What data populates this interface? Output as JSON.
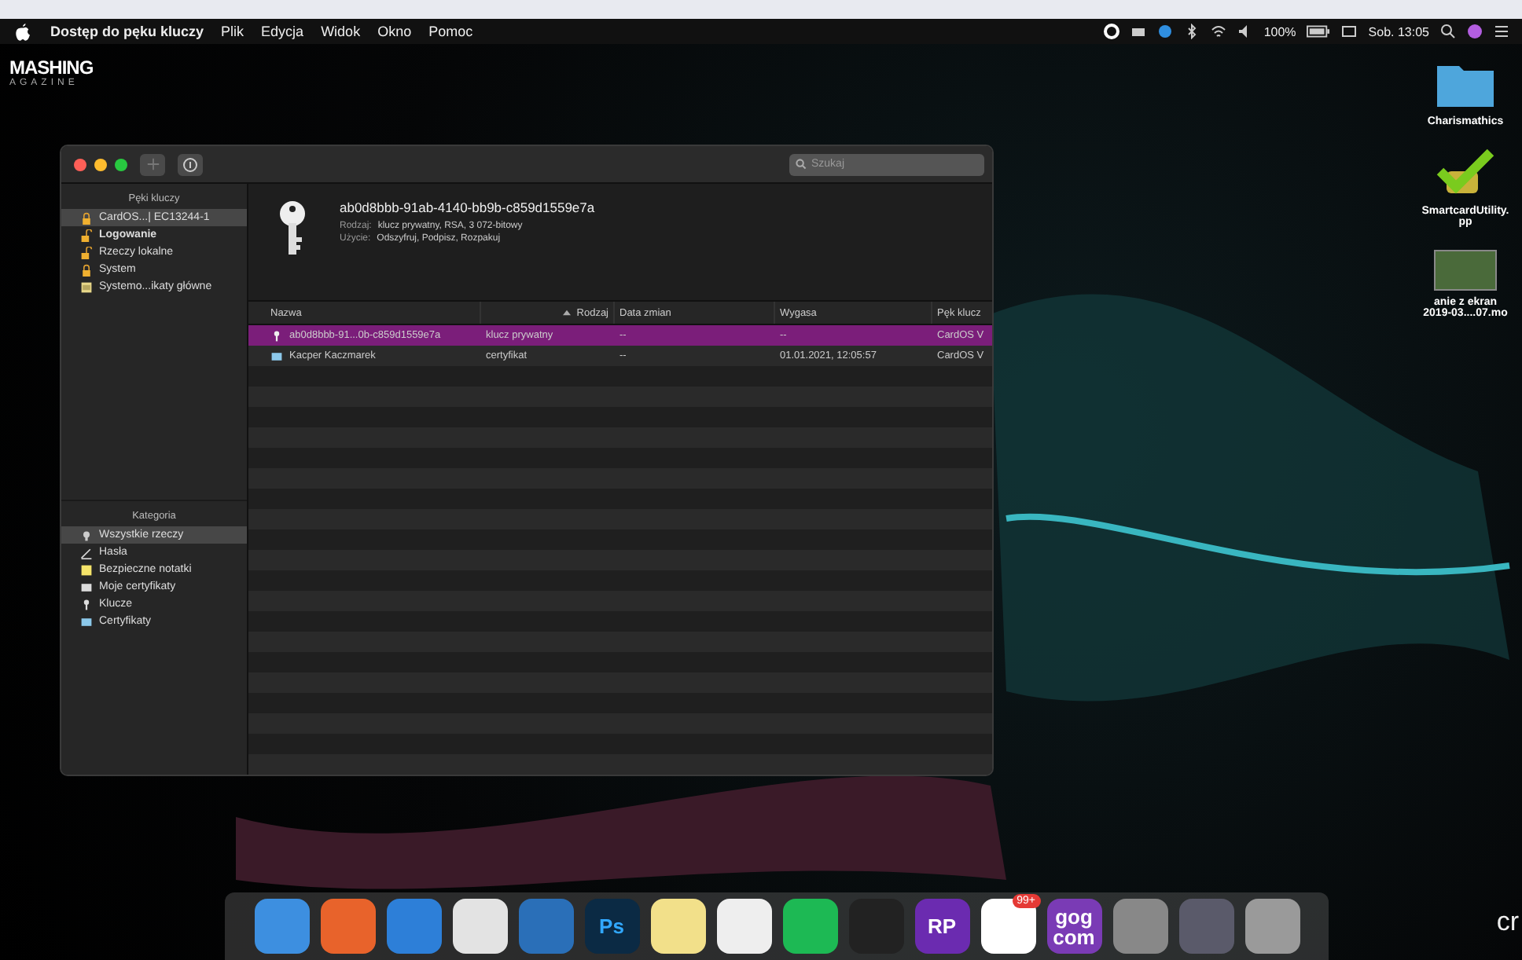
{
  "menu_bar": {
    "app_name": "Dostęp do pęku kluczy",
    "menus": [
      "Plik",
      "Edycja",
      "Widok",
      "Okno",
      "Pomoc"
    ],
    "battery": "100%",
    "clock": "Sob. 13:05"
  },
  "logo": {
    "line_1": "MASHING",
    "line_2": "AGAZINE"
  },
  "window": {
    "search": {
      "placeholder": "Szukaj"
    },
    "keychains": {
      "title": "Pęki kluczy",
      "items": [
        {
          "label": "CardOS...| EC13244-1",
          "kind": "lock",
          "selected": true,
          "bold": false
        },
        {
          "label": "Logowanie",
          "kind": "unlock",
          "selected": false,
          "bold": true
        },
        {
          "label": "Rzeczy lokalne",
          "kind": "unlock",
          "selected": false,
          "bold": false
        },
        {
          "label": "System",
          "kind": "lock",
          "selected": false,
          "bold": false
        },
        {
          "label": "Systemo...ikaty główne",
          "kind": "cabinet",
          "selected": false,
          "bold": false
        }
      ]
    },
    "categories": {
      "title": "Kategoria",
      "items": [
        {
          "label": "Wszystkie rzeczy",
          "kind": "all",
          "selected": true
        },
        {
          "label": "Hasła",
          "kind": "pen",
          "selected": false
        },
        {
          "label": "Bezpieczne notatki",
          "kind": "note",
          "selected": false
        },
        {
          "label": "Moje certyfikaty",
          "kind": "mycert",
          "selected": false
        },
        {
          "label": "Klucze",
          "kind": "key",
          "selected": false
        },
        {
          "label": "Certyfikaty",
          "kind": "cert",
          "selected": false
        }
      ]
    },
    "detail": {
      "title": "ab0d8bbb-91ab-4140-bb9b-c859d1559e7a",
      "fields": [
        {
          "label": "Rodzaj:",
          "value": "klucz prywatny, RSA, 3 072-bitowy"
        },
        {
          "label": "Użycie:",
          "value": "Odszyfruj, Podpisz, Rozpakuj"
        }
      ]
    },
    "table": {
      "columns": [
        {
          "label": "Nazwa",
          "sorted": false
        },
        {
          "label": "Rodzaj",
          "sorted": true
        },
        {
          "label": "Data zmian",
          "sorted": false
        },
        {
          "label": "Wygasa",
          "sorted": false
        },
        {
          "label": "Pęk klucz",
          "sorted": false
        }
      ],
      "rows": [
        {
          "kind": "key",
          "selected": true,
          "cells": [
            "ab0d8bbb-91...0b-c859d1559e7a",
            "klucz prywatny",
            "--",
            "--",
            "CardOS V"
          ]
        },
        {
          "kind": "cert",
          "selected": false,
          "cells": [
            "Kacper Kaczmarek",
            "certyfikat",
            "--",
            "01.01.2021, 12:05:57",
            "CardOS V"
          ]
        }
      ]
    }
  },
  "desktop_icons": [
    {
      "kind": "folder",
      "lines": [
        "Charismathics"
      ]
    },
    {
      "kind": "app",
      "lines": [
        "SmartcardUtility.",
        "pp"
      ]
    },
    {
      "kind": "video",
      "lines": [
        "anie z ekran",
        "2019-03....07.mo"
      ]
    }
  ],
  "corner_logo": "cr",
  "dock": [
    {
      "kind": "finder"
    },
    {
      "kind": "firefox"
    },
    {
      "kind": "safari"
    },
    {
      "kind": "chrome"
    },
    {
      "kind": "vscode"
    },
    {
      "kind": "ps",
      "label": "Ps"
    },
    {
      "kind": "notes"
    },
    {
      "kind": "photos"
    },
    {
      "kind": "spotify"
    },
    {
      "kind": "terminal"
    },
    {
      "kind": "rp",
      "label": "RP"
    },
    {
      "kind": "badge-app",
      "badge": "99+"
    },
    {
      "kind": "gog",
      "label": "gog com"
    },
    {
      "kind": "keychain"
    },
    {
      "kind": "screen"
    },
    {
      "kind": "trash"
    }
  ]
}
